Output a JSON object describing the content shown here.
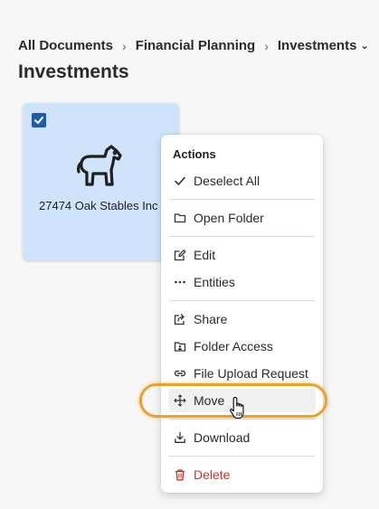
{
  "breadcrumb": {
    "items": [
      "All Documents",
      "Financial Planning",
      "Investments"
    ]
  },
  "page_title": "Investments",
  "card": {
    "label": "27474 Oak Stables Inc",
    "icon": "horse-icon",
    "selected": true,
    "background": "#cfe3fb"
  },
  "menu": {
    "header": "Actions",
    "items": [
      {
        "label": "Deselect All",
        "icon": "check-icon"
      },
      {
        "label": "Open Folder",
        "icon": "folder-icon"
      },
      {
        "label": "Edit",
        "icon": "edit-icon"
      },
      {
        "label": "Entities",
        "icon": "ellipsis-icon"
      },
      {
        "label": "Share",
        "icon": "share-icon"
      },
      {
        "label": "Folder Access",
        "icon": "folder-user-icon"
      },
      {
        "label": "File Upload Request",
        "icon": "link-icon"
      },
      {
        "label": "Move",
        "icon": "move-icon"
      },
      {
        "label": "Download",
        "icon": "download-icon"
      },
      {
        "label": "Delete",
        "icon": "trash-icon"
      }
    ]
  },
  "colors": {
    "highlight": "#e9a22a",
    "danger": "#c9302c",
    "checkbox": "#1d5ea8"
  }
}
